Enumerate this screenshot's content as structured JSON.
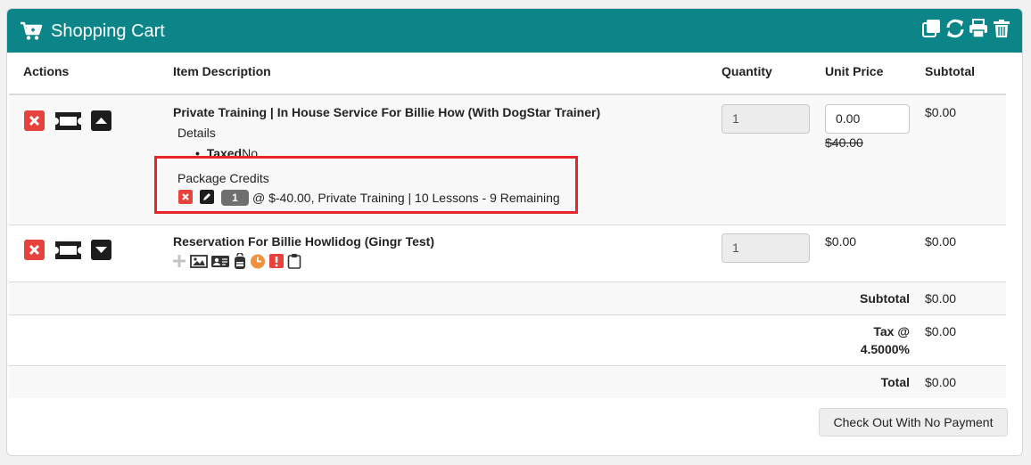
{
  "header": {
    "title": "Shopping Cart",
    "icons": [
      "cart-icon",
      "copy-icon",
      "refresh-icon",
      "print-icon",
      "trash-icon"
    ],
    "bg_color": "#0b8588"
  },
  "table": {
    "columns": {
      "actions": "Actions",
      "description": "Item Description",
      "quantity": "Quantity",
      "unit_price": "Unit Price",
      "subtotal": "Subtotal"
    }
  },
  "items": [
    {
      "title": "Private Training | In House Service For Billie How (With DogStar Trainer)",
      "details_label": "Details",
      "detail_key": "Taxed",
      "detail_value": "No",
      "package_label": "Package Credits",
      "package_count": "1",
      "package_text": "@ $-40.00, Private Training | 10 Lessons - 9 Remaining",
      "quantity": "1",
      "unit_price": "0.00",
      "original_price": "$40.00",
      "subtotal": "$0.00"
    },
    {
      "title": "Reservation For Billie Howlidog (Gingr Test)",
      "quantity": "1",
      "unit_price": "$0.00",
      "subtotal": "$0.00"
    }
  ],
  "totals": {
    "subtotal_label": "Subtotal",
    "subtotal_value": "$0.00",
    "tax_label_line1": "Tax @",
    "tax_label_line2": "4.5000%",
    "tax_value": "$0.00",
    "total_label": "Total",
    "total_value": "$0.00"
  },
  "checkout_button": "Check Out With No Payment",
  "colors": {
    "danger": "#e8423c",
    "highlight": "#e8262a",
    "warning": "#f0913b"
  }
}
